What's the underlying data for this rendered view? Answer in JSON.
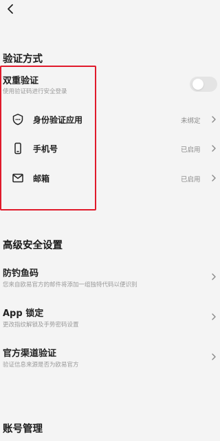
{
  "nav": {
    "back_icon": "chevron-left-icon"
  },
  "verify": {
    "title": "验证方式",
    "two_factor": {
      "title": "双重验证",
      "desc": "使用验证码进行安全登录",
      "toggle_on": false
    },
    "items": [
      {
        "label": "身份验证应用",
        "status": "未绑定",
        "icon": "shield-check-icon"
      },
      {
        "label": "手机号",
        "status": "已启用",
        "icon": "phone-icon"
      },
      {
        "label": "邮箱",
        "status": "已启用",
        "icon": "mail-icon"
      }
    ]
  },
  "advanced": {
    "title": "高级安全设置",
    "items": [
      {
        "label": "防钓鱼码",
        "desc": "您来自欧易官方的邮件将添加一组独特代码以便识别"
      },
      {
        "label": "App 锁定",
        "desc": "更改指纹解锁及手势密码设置"
      },
      {
        "label": "官方渠道验证",
        "desc": "验证信息来源是否为欧易官方"
      }
    ]
  },
  "account": {
    "title": "账号管理"
  },
  "colors": {
    "highlight_border": "#e0192a",
    "background": "#f4f4f4"
  }
}
